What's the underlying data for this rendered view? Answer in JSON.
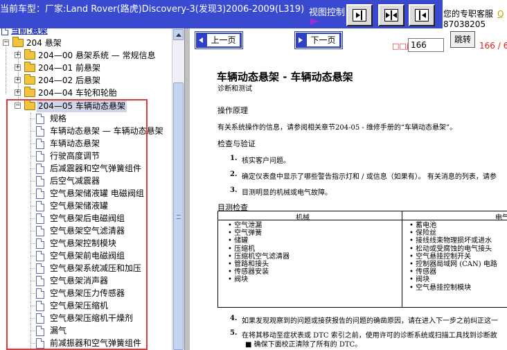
{
  "topbar": {
    "car_line": "当前车型：厂家:Land Rover(路虎)Discovery-3(发现3)2006-2009(L319)",
    "view_control": "视图控制",
    "service_label": "您的专职客服",
    "service_link": "Q",
    "service_phone": "87038205"
  },
  "tree": {
    "root": "当前:悬架",
    "section": "204 悬架",
    "groups": [
      {
        "label": "204—00 悬架系统 — 常规信息"
      },
      {
        "label": "204—01 前悬架"
      },
      {
        "label": "204—02 后悬架"
      },
      {
        "label": "204—04 车轮和轮胎"
      },
      {
        "label": "204—05 车辆动态悬架"
      }
    ],
    "items": [
      "规格",
      "车辆动态悬架 — 车辆动态悬架",
      "车辆动态悬架",
      "行驶高度调节",
      "后减震器和空气弹簧组件",
      "后空气减震器",
      "空气悬架储液罐 电磁阀组",
      "空气悬架储液罐",
      "空气悬架后电磁阀组",
      "空气悬架空气滤清器",
      "空气悬架控制模块",
      "空气悬架前电磁阀组",
      "空气悬架系统减压和加压",
      "空气悬架消声器",
      "空气悬架压力传感器",
      "空气悬架压缩机",
      "空气悬架压缩机干燥剂",
      "漏气",
      "前减振器和空气弹簧组件"
    ]
  },
  "nav": {
    "prev": "上一页",
    "next": "下一页",
    "page_label": "□□jl",
    "page_value": "166",
    "jump": "跳转",
    "page_count": "166 / 6"
  },
  "doc": {
    "title": "车辆动态悬架 - 车辆动态悬架",
    "subtitle": "诊断和测试",
    "principle_heading": "操作原理",
    "principle_text": "有关系统操作的信息，请参阅相关章节204-05 - 维修手册的“车辆动态悬架”。",
    "inspect_heading": "检查与验证",
    "steps": [
      {
        "n": "1.",
        "text": "核实客户问题。"
      },
      {
        "n": "2.",
        "text": "确定仪表盘中显示了哪些警告指示灯和 / 或信息（如果有）。 有关消息的列表，请参"
      },
      {
        "n": "3.",
        "text": "目测明显的机械或电气故障。"
      }
    ],
    "visual_heading": "目测检查",
    "table": {
      "col_mech": "机械",
      "col_elec": "电气",
      "mech_items": [
        "空气泄漏",
        "空气弹簧",
        "储罐",
        "压缩机",
        "压缩机空气滤清器",
        "管路和接头",
        "传感器安装",
        "阀块"
      ],
      "elec_items": [
        "蓄电池",
        "保险丝",
        "接线线束物理损坏或进水",
        "松动或受腐蚀的电气接头",
        "空气悬挂控制开关",
        "控制器局域网 (CAN) 电路",
        "传感器",
        "阀块",
        "空气悬挂控制模块"
      ]
    },
    "step4": {
      "n": "4.",
      "text": "如果发现观察到的问题或接获报告的问题的确凿原因，请在进入下一步之前纠正这一"
    },
    "step5": {
      "n": "5.",
      "text": "在将其移动至症状表或 DTC 索引之前，使用许可的诊断系统或扫描工具找到诊断故"
    },
    "step5_bullet": "确保下面校正清除了所有的 DTC。"
  }
}
